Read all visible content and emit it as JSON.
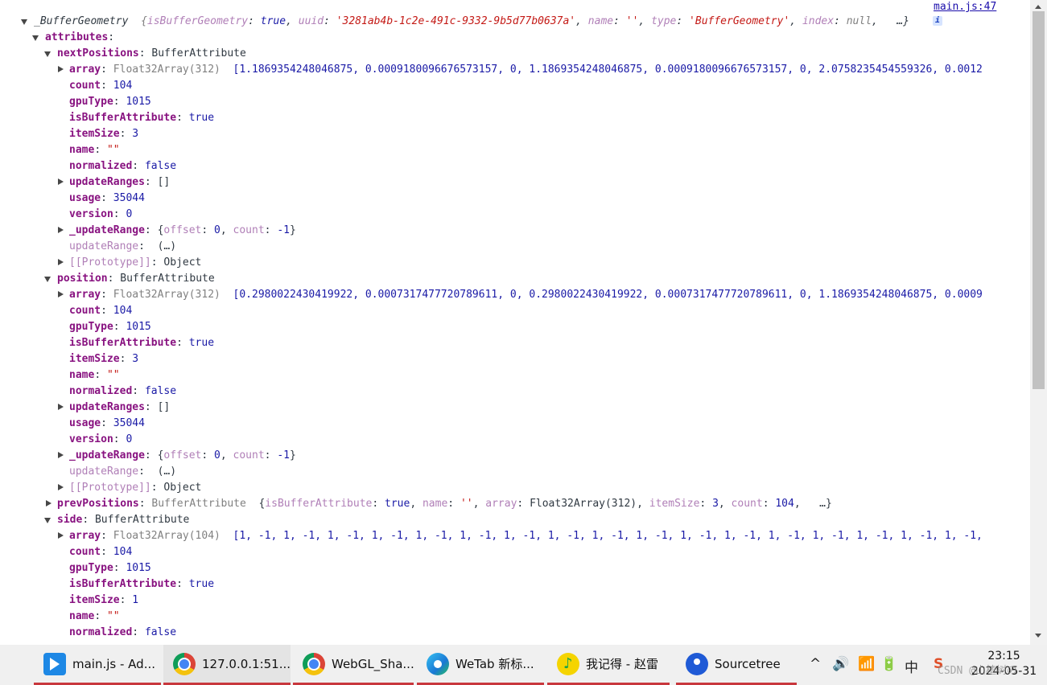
{
  "console": {
    "source_link": "main.js:47",
    "info_icon_glyph": "i",
    "header": {
      "name": "_BufferGeometry",
      "preview_open": "{",
      "k1": "isBufferGeometry",
      "v1": "true",
      "k2": "uuid",
      "v2": "'3281ab4b-1c2e-491c-9332-9b5d77b0637a'",
      "k3": "name",
      "v3": "''",
      "k4": "type",
      "v4": "'BufferGeometry'",
      "k5": "index",
      "v5": "null",
      "ellipsis": "…}"
    },
    "attributes_key": "attributes",
    "nextPositions": {
      "key": "nextPositions",
      "type": "BufferAttribute",
      "array_type": "Float32Array(312)",
      "array_preview": "[1.1869354248046875, 0.0009180096676573157, 0, 1.1869354248046875, 0.0009180096676573157, 0, 2.0758235454559326, 0.0012"
    },
    "position": {
      "key": "position",
      "type": "BufferAttribute",
      "array_type": "Float32Array(312)",
      "array_preview": "[0.2980022430419922, 0.0007317477720789611, 0, 0.2980022430419922, 0.0007317477720789611, 0, 1.1869354248046875, 0.0009"
    },
    "prevPositions": {
      "key": "prevPositions",
      "type": "BufferAttribute",
      "preview": {
        "k1": "isBufferAttribute",
        "v1": "true",
        "k2": "name",
        "v2": "''",
        "k3": "array",
        "v3": "Float32Array(312)",
        "k4": "itemSize",
        "v4": "3",
        "k5": "count",
        "v5": "104",
        "ellipsis": "…}"
      }
    },
    "side": {
      "key": "side",
      "type": "BufferAttribute",
      "array_type": "Float32Array(104)",
      "array_preview": "[1, -1, 1, -1, 1, -1, 1, -1, 1, -1, 1, -1, 1, -1, 1, -1, 1, -1, 1, -1, 1, -1, 1, -1, 1, -1, 1, -1, 1, -1, 1, -1, 1, -1,"
    },
    "labels": {
      "array": "array",
      "count": "count",
      "gpuType": "gpuType",
      "isBufferAttribute": "isBufferAttribute",
      "itemSize": "itemSize",
      "name": "name",
      "normalized": "normalized",
      "updateRanges": "updateRanges",
      "usage": "usage",
      "version": "version",
      "_updateRange": "_updateRange",
      "updateRange": "updateRange",
      "prototype": "[[Prototype]]"
    },
    "values": {
      "count": "104",
      "gpuType": "1015",
      "true": "true",
      "false": "false",
      "itemSize3": "3",
      "itemSize1": "1",
      "emptyName": "\"\"",
      "emptyArray": "[]",
      "usage": "35044",
      "version": "0",
      "updateRangeObj_open": "{",
      "offsetKey": "offset",
      "offsetVal": "0",
      "countKey": "count",
      "countVal": "-1",
      "updateRangeObj_close": "}",
      "getter": "(…)",
      "object": "Object"
    }
  },
  "taskbar": {
    "apps": [
      {
        "label": "main.js - Ad...",
        "icon": "vscode-icon"
      },
      {
        "label": "127.0.0.1:51...",
        "icon": "chrome-icon"
      },
      {
        "label": "WebGL_Sha...",
        "icon": "chrome-icon"
      },
      {
        "label": "WeTab 新标...",
        "icon": "edge-icon"
      },
      {
        "label": "我记得 - 赵雷",
        "icon": "music-icon"
      },
      {
        "label": "Sourcetree",
        "icon": "sourcetree-icon"
      }
    ],
    "tray": {
      "chevron": "^",
      "volume": "🔊",
      "wifi": "📶",
      "battery": "🔋",
      "ime": "中",
      "sogou": "S"
    },
    "clock_time": "23:15",
    "clock_date": "2024-05-31",
    "watermark": "CSDN @山楂树の"
  },
  "colors": {
    "accent_underline": "#c8373d",
    "key_purple": "#881280",
    "number_blue": "#1a1aa6",
    "string_red": "#c41a16"
  }
}
